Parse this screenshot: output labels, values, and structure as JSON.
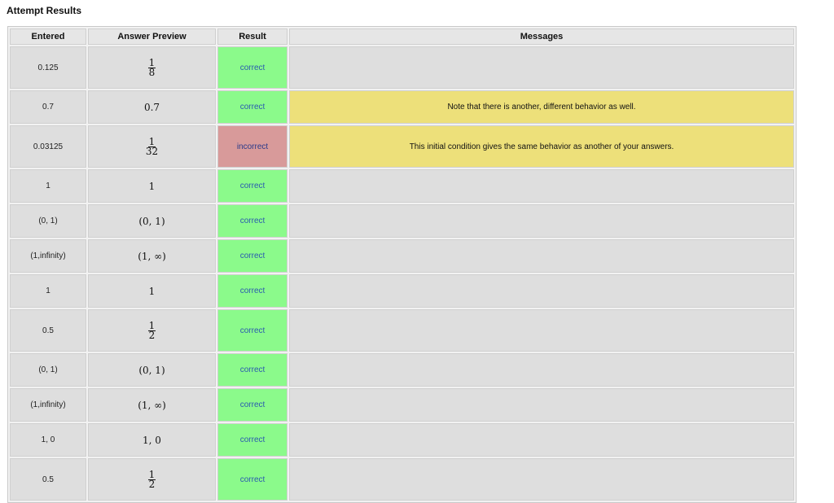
{
  "page": {
    "title": "Attempt Results"
  },
  "table": {
    "headers": {
      "entered": "Entered",
      "preview": "Answer Preview",
      "result": "Result",
      "messages": "Messages"
    },
    "rows": [
      {
        "entered": "0.125",
        "preview": {
          "type": "fraction",
          "num": "1",
          "den": "8"
        },
        "result": "correct",
        "message": ""
      },
      {
        "entered": "0.7",
        "preview": {
          "type": "text",
          "text": "0.7"
        },
        "result": "correct",
        "message": "Note that there is another, different behavior as well."
      },
      {
        "entered": "0.03125",
        "preview": {
          "type": "fraction",
          "num": "1",
          "den": "32"
        },
        "result": "incorrect",
        "message": "This initial condition gives the same behavior as another of your answers."
      },
      {
        "entered": "1",
        "preview": {
          "type": "text",
          "text": "1"
        },
        "result": "correct",
        "message": ""
      },
      {
        "entered": "(0, 1)",
        "preview": {
          "type": "text",
          "text": "(0, 1)"
        },
        "result": "correct",
        "message": ""
      },
      {
        "entered": "(1,infinity)",
        "preview": {
          "type": "text",
          "text": "(1, ∞)"
        },
        "result": "correct",
        "message": ""
      },
      {
        "entered": "1",
        "preview": {
          "type": "text",
          "text": "1"
        },
        "result": "correct",
        "message": ""
      },
      {
        "entered": "0.5",
        "preview": {
          "type": "fraction",
          "num": "1",
          "den": "2"
        },
        "result": "correct",
        "message": ""
      },
      {
        "entered": "(0, 1)",
        "preview": {
          "type": "text",
          "text": "(0, 1)"
        },
        "result": "correct",
        "message": ""
      },
      {
        "entered": "(1,infinity)",
        "preview": {
          "type": "text",
          "text": "(1, ∞)"
        },
        "result": "correct",
        "message": ""
      },
      {
        "entered": "1, 0",
        "preview": {
          "type": "text",
          "text": "1, 0"
        },
        "result": "correct",
        "message": ""
      },
      {
        "entered": "0.5",
        "preview": {
          "type": "fraction",
          "num": "1",
          "den": "2"
        },
        "result": "correct",
        "message": ""
      }
    ]
  },
  "colors": {
    "correct": "#8bfa8b",
    "incorrect": "#d89a9a",
    "message_highlight": "#ede07a",
    "cell": "#dedede"
  }
}
